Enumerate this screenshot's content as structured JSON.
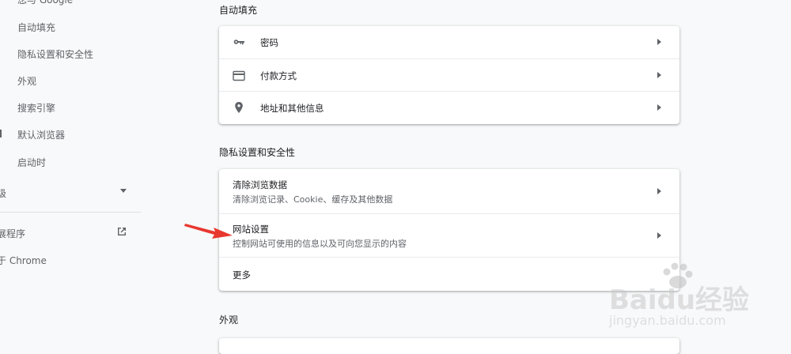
{
  "sidebar": {
    "items": [
      {
        "label": "您与 Google"
      },
      {
        "label": "自动填充"
      },
      {
        "label": "隐私设置和安全性"
      },
      {
        "label": "外观"
      },
      {
        "label": "搜索引擎"
      },
      {
        "label": "默认浏览器"
      },
      {
        "label": "启动时"
      }
    ],
    "advanced_label": "级",
    "extensions_label": "展程序",
    "about_label": "于 Chrome"
  },
  "autofill": {
    "title": "自动填充",
    "rows": [
      {
        "label": "密码",
        "icon": "key-icon"
      },
      {
        "label": "付款方式",
        "icon": "credit-card-icon"
      },
      {
        "label": "地址和其他信息",
        "icon": "location-pin-icon"
      }
    ]
  },
  "privacy": {
    "title": "隐私设置和安全性",
    "rows": [
      {
        "label": "清除浏览数据",
        "sub": "清除浏览记录、Cookie、缓存及其他数据"
      },
      {
        "label": "网站设置",
        "sub": "控制网站可使用的信息以及可向您显示的内容"
      }
    ],
    "more_label": "更多"
  },
  "appearance": {
    "title": "外观"
  },
  "watermark": {
    "brand": "Baidu经验",
    "url": "jingyan.baidu.com"
  },
  "colors": {
    "annotation_arrow": "#e8372f",
    "page_bg": "#f8f9fa",
    "card_bg": "#ffffff"
  }
}
